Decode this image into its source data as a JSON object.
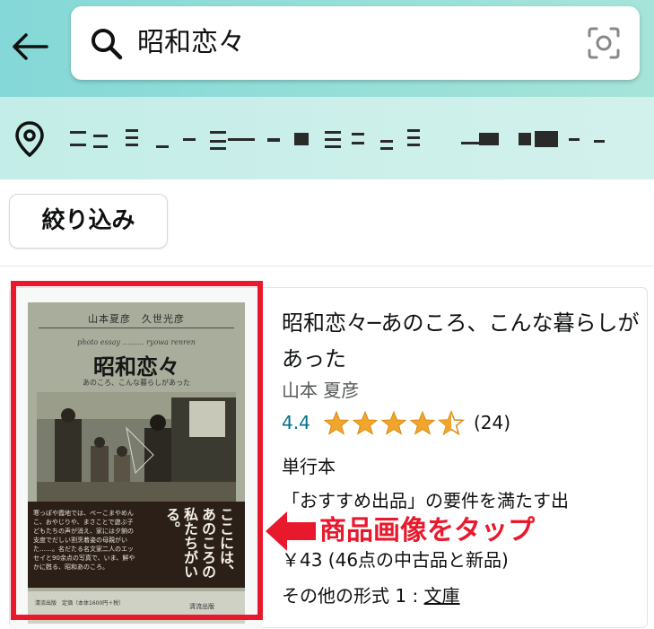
{
  "search": {
    "query": "昭和恋々"
  },
  "location": {
    "address_masked": "(blurred address)"
  },
  "filter": {
    "label": "絞り込み"
  },
  "product": {
    "title": "昭和恋々─あのころ、こんな暮らしがあった",
    "author": "山本 夏彦",
    "rating": "4.4",
    "rating_value": 4.4,
    "max_rating": 5,
    "review_count": "(24)",
    "format": "単行本",
    "notice": "「おすすめ出品」の要件を満たす出",
    "price": "￥43 (46点の中古品と新品)",
    "other_formats_label": "その他の形式 1 : ",
    "other_formats_link": "文庫",
    "cover": {
      "authors": "山本夏彦　久世光彦",
      "english": "photo essay ……… ryowa renren",
      "title": "昭和恋々",
      "subtitle": "あのころ、こんな暮らしがあった",
      "blurb": "寒っぽや霞地では、ぺーこまやめんこ、おやじりや、まさことで遊ぶ子どもたちの声が消え、家には夕餉の支度でだしい割烹着姿の母親がいた……。名だたる名文家二人のエッセイと90余点の写真で、いま、鮮やかに甦る、昭和あのころ。",
      "vertical": "ここには、あのころの私たちがいる。",
      "publisher_info": "清流出版　定価（本体1600円＋税）",
      "publisher": "清流出版"
    }
  },
  "annotation": {
    "text": "商品画像をタップ"
  },
  "colors": {
    "accent_red": "#e8192c",
    "link_teal": "#007185",
    "star_orange": "#f2a52c"
  }
}
